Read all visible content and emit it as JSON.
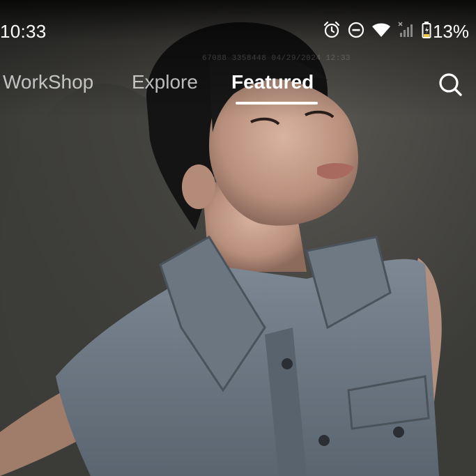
{
  "status_bar": {
    "time": "10:33",
    "battery_percent": "13%",
    "icons": [
      "alarm-icon",
      "do-not-disturb-icon",
      "wifi-icon",
      "signal-icon",
      "battery-charging-icon"
    ]
  },
  "watermark": "67088  3358448  04/29/2024 12:33",
  "tabs": [
    {
      "label": "WorkShop",
      "active": false
    },
    {
      "label": "Explore",
      "active": false
    },
    {
      "label": "Featured",
      "active": true
    }
  ],
  "search_icon": "search-icon",
  "colors": {
    "text": "#ffffff",
    "inactive_tab": "#ebebeb",
    "background": "#4a4a46"
  }
}
